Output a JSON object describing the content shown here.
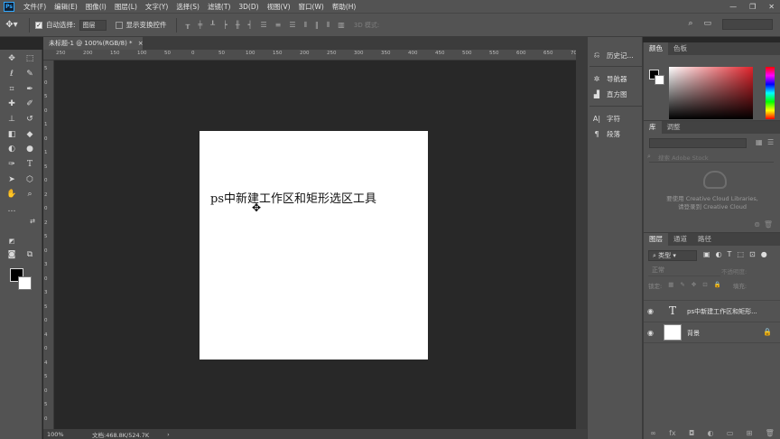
{
  "app": {
    "logo": "Ps"
  },
  "menu": [
    "文件(F)",
    "编辑(E)",
    "图像(I)",
    "图层(L)",
    "文字(Y)",
    "选择(S)",
    "滤镜(T)",
    "3D(D)",
    "视图(V)",
    "窗口(W)",
    "帮助(H)"
  ],
  "window": {
    "minimize": "—",
    "restore": "❐",
    "close": "✕"
  },
  "options": {
    "auto_select_label": "自动选择:",
    "auto_select_value": "图层",
    "show_transform_label": "显示变换控件",
    "mode_3d_label": "3D 模式:"
  },
  "document": {
    "tab_title": "未标题-1 @ 100%(RGB/8) *",
    "tab_close": "×",
    "canvas_text": "ps中新建工作区和矩形选区工具",
    "ruler_h": [
      "250",
      "200",
      "150",
      "100",
      "50",
      "0",
      "50",
      "100",
      "150",
      "200",
      "250",
      "300",
      "350",
      "400",
      "450",
      "500",
      "550",
      "600",
      "650",
      "700"
    ],
    "ruler_v": [
      "5",
      "0",
      "5",
      "0",
      "1",
      "0",
      "1",
      "5",
      "0",
      "2",
      "0",
      "2",
      "5",
      "0",
      "3",
      "0",
      "3",
      "5",
      "0",
      "4",
      "0",
      "4",
      "5",
      "0",
      "5",
      "0"
    ],
    "status_zoom": "100%",
    "status_doc": "文档:468.8K/524.7K",
    "status_arrow": "›"
  },
  "side_panels": {
    "history": "历史记...",
    "navigator": "导航器",
    "histogram": "直方图",
    "character": "字符",
    "paragraph": "段落"
  },
  "color_panel": {
    "tabs": [
      "颜色",
      "色板"
    ]
  },
  "library_panel": {
    "tabs": [
      "库",
      "调整"
    ],
    "search_placeholder": "搜索 Adobe Stock",
    "message_line1": "要使用 Creative Cloud Libraries,",
    "message_line2": "请登录到 Creative Cloud"
  },
  "layers_panel": {
    "tabs": [
      "图层",
      "通道",
      "路径"
    ],
    "filter_kind": "类型",
    "blend_mode": "正常",
    "opacity_label": "不透明度:",
    "lock_label": "锁定:",
    "fill_label": "填充:",
    "layers": [
      {
        "thumb": "T",
        "name": "ps中新建工作区和矩形..."
      },
      {
        "thumb": "",
        "name": "背景"
      }
    ]
  },
  "colors": {
    "chrome": "#535353",
    "pasteboard": "#282828",
    "canvas": "#ffffff",
    "accent": "#31a8ff"
  }
}
